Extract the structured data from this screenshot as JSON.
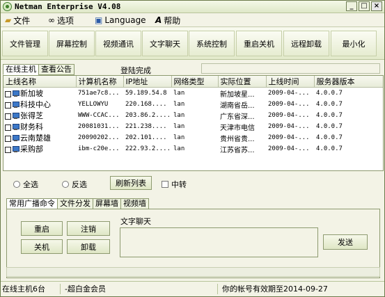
{
  "window": {
    "title": "Netman Enterprise V4.08",
    "buttons": [
      "_",
      "□",
      "×"
    ]
  },
  "menu": {
    "file": "文件",
    "options": "选项",
    "language": "Language",
    "help": "帮助"
  },
  "toolbar": {
    "file_manage": "文件管理",
    "screen_control": "屏幕控制",
    "video_comm": "视频通讯",
    "text_chat": "文字聊天",
    "system_control": "系统控制",
    "restart_shutdown": "重启关机",
    "remote_uninstall": "远程卸载",
    "minimize": "最小化"
  },
  "top_tabs": {
    "online_hosts": "在线主机",
    "view_notice": "查看公告"
  },
  "login_status": "登陆完成",
  "hosts_table": {
    "headers": [
      "上线名称",
      "计算机名称",
      "IP地址",
      "网络类型",
      "实际位置",
      "上线时间",
      "服务器版本"
    ],
    "rows": [
      [
        "新加坡",
        "751ae7c8...",
        "59.189.54.8",
        "lan",
        "新加坡星...",
        "2009-04-...",
        "4.0.0.7"
      ],
      [
        "科技中心",
        "YELLOWYU",
        "220.168....",
        "lan",
        "湖南省岳...",
        "2009-04-...",
        "4.0.0.7"
      ],
      [
        "张得芝",
        "WWW-CCAC...",
        "203.86.2....",
        "lan",
        "广东省深...",
        "2009-04-...",
        "4.0.0.7"
      ],
      [
        "财务科",
        "20081031...",
        "221.238....",
        "lan",
        "天津市电信",
        "2009-04-...",
        "4.0.0.7"
      ],
      [
        "云南楚雄",
        "20090202...",
        "202.101....",
        "lan",
        "贵州省贵...",
        "2009-04-...",
        "4.0.0.7"
      ],
      [
        "采购部",
        "ibm-c20e...",
        "222.93.2....",
        "lan",
        "江苏省苏...",
        "2009-04-...",
        "4.0.0.7"
      ]
    ]
  },
  "controls": {
    "select_all": "全选",
    "invert": "反选",
    "refresh": "刷新列表",
    "relay": "中转"
  },
  "bottom_tabs": {
    "broadcast": "常用广播命令",
    "file_distribute": "文件分发",
    "screen_wall": "屏幕墙",
    "video_wall": "视频墙"
  },
  "commands": {
    "restart": "重启",
    "logout": "注销",
    "shutdown": "关机",
    "uninstall": "卸载"
  },
  "chat": {
    "label": "文字聊天",
    "send": "发送"
  },
  "status": {
    "online_count": "在线主机6台",
    "member": "-超白金会员",
    "expiry": "你的帐号有效期至2014-09-27"
  }
}
